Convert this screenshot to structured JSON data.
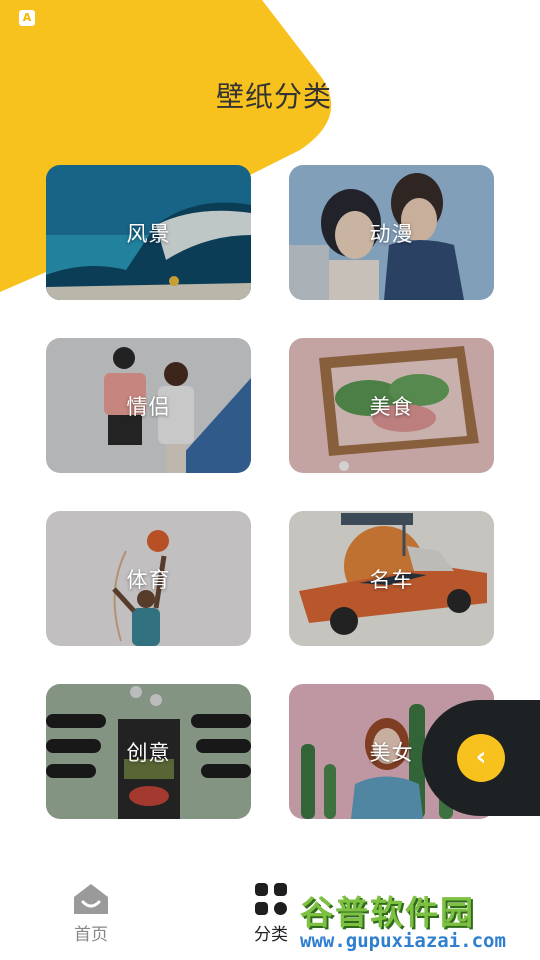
{
  "app_badge": "A",
  "header": {
    "title": "壁纸分类"
  },
  "categories": [
    {
      "label": "风景"
    },
    {
      "label": "动漫"
    },
    {
      "label": "情侣"
    },
    {
      "label": "美食"
    },
    {
      "label": "体育"
    },
    {
      "label": "名车"
    },
    {
      "label": "创意"
    },
    {
      "label": "美女"
    }
  ],
  "float_button": {
    "icon": "chevron-left-icon",
    "glyph": "‹"
  },
  "bottom_nav": [
    {
      "label": "首页",
      "icon": "home-icon",
      "active": false
    },
    {
      "label": "分类",
      "icon": "grid-icon",
      "active": true
    }
  ],
  "watermark": {
    "title": "谷普软件园",
    "url": "www.gupuxiazai.com"
  },
  "colors": {
    "accent": "#F8C21E",
    "dark": "#1E2124",
    "text": "#333333"
  }
}
